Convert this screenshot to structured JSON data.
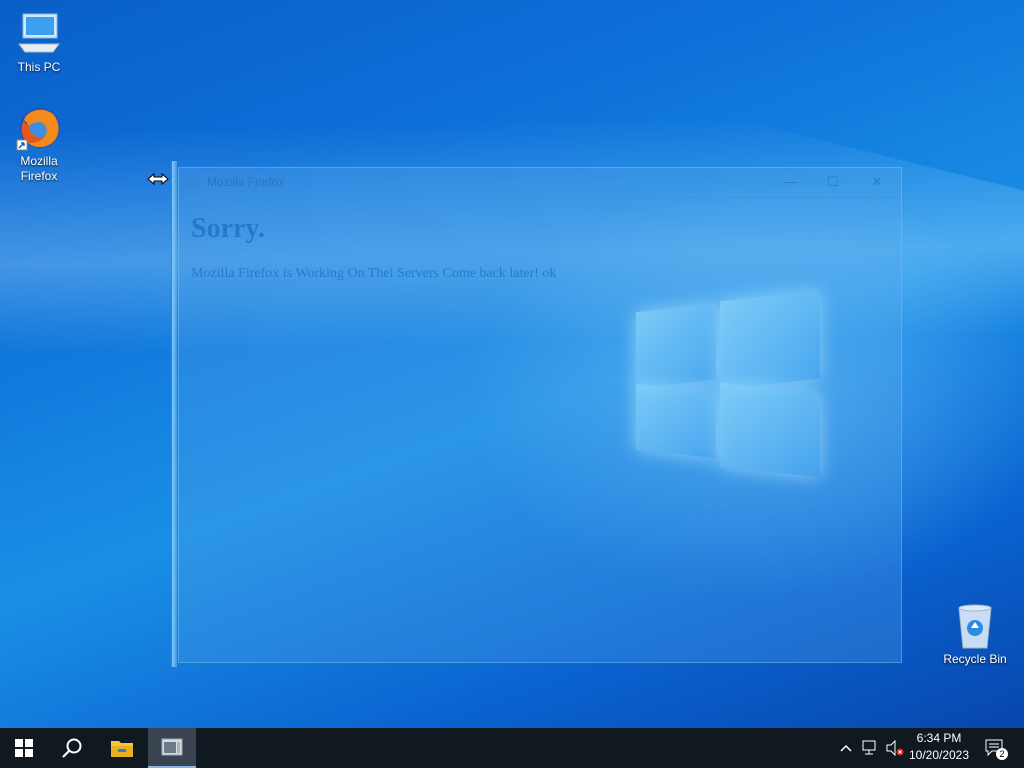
{
  "desktop": {
    "icons": [
      {
        "label": "This PC",
        "icon": "computer-icon"
      },
      {
        "label": "Mozilla Firefox",
        "icon": "firefox-icon"
      },
      {
        "label": "Recycle Bin",
        "icon": "recycle-bin-icon"
      }
    ]
  },
  "window": {
    "title": "Mozilla Firefox",
    "heading": "Sorry.",
    "message": "Mozilla Firefox is Working On Thei Servers Come back later! ok",
    "controls": {
      "minimize": "—",
      "maximize": "☐",
      "close": "✕"
    }
  },
  "taskbar": {
    "start": "windows-start-icon",
    "search": "search-icon",
    "explorer": "file-explorer-icon",
    "active_app": "app-window-icon",
    "tray": {
      "chevron": "^",
      "time": "6:34 PM",
      "date": "10/20/2023",
      "notifications_count": "2"
    }
  },
  "colors": {
    "taskbar": "#101820",
    "desktop_accent": "#0d6fd8"
  }
}
